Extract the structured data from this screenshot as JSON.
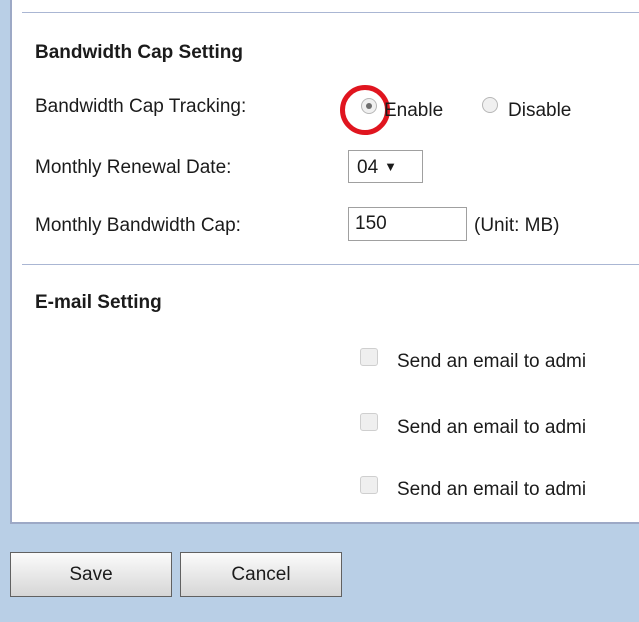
{
  "bandwidth": {
    "heading": "Bandwidth Cap Setting",
    "tracking_label": "Bandwidth Cap Tracking:",
    "enable_label": "Enable",
    "disable_label": "Disable",
    "tracking_selected": "Enable",
    "renewal_label": "Monthly Renewal Date:",
    "renewal_value": "04",
    "cap_label": "Monthly Bandwidth Cap:",
    "cap_value": "150",
    "cap_unit": "(Unit: MB)"
  },
  "email": {
    "heading": "E-mail Setting",
    "options": [
      {
        "label": "Send an email to admi",
        "checked": false
      },
      {
        "label": "Send an email to admi",
        "checked": false
      },
      {
        "label": "Send an email to admi",
        "checked": false
      }
    ]
  },
  "footer": {
    "save_label": "Save",
    "cancel_label": "Cancel"
  },
  "colors": {
    "page_background": "#b9cfe6",
    "highlight_ring": "#e0151f",
    "divider": "#aab6d3"
  }
}
